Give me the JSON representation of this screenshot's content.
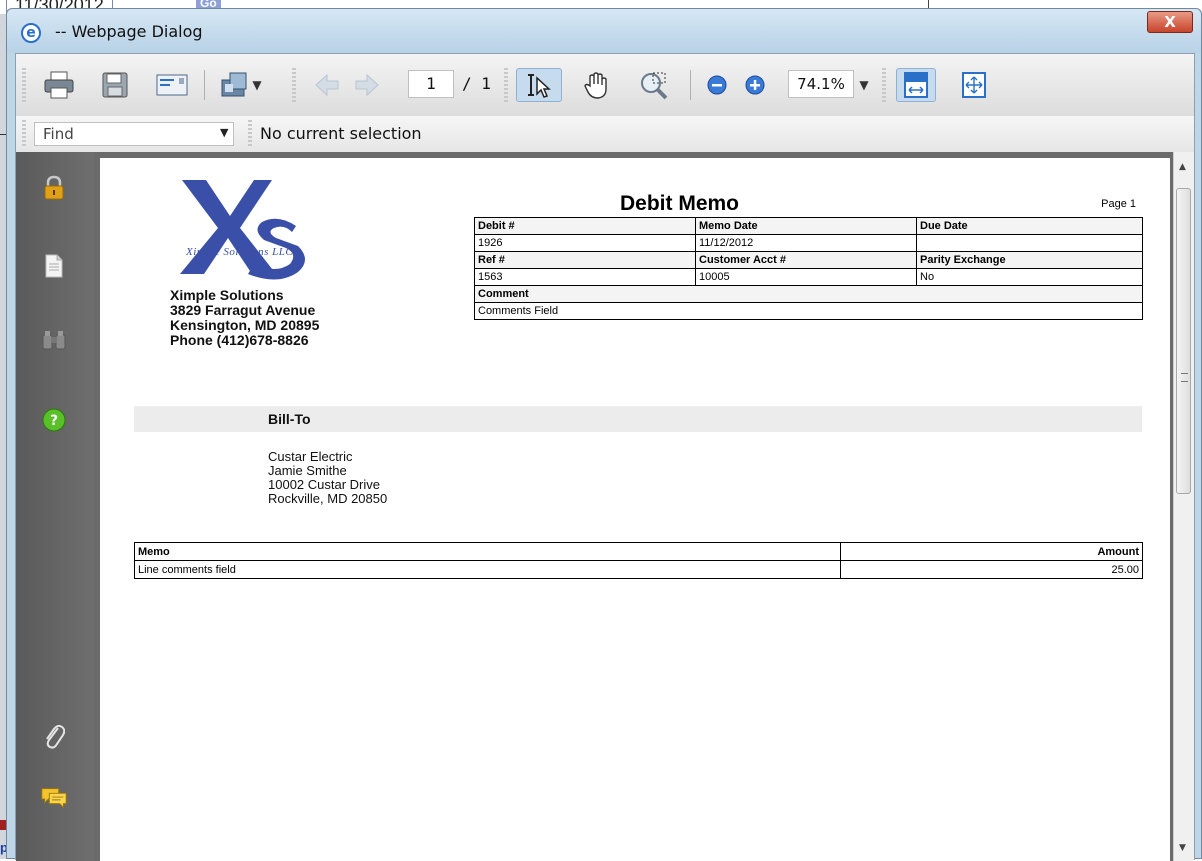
{
  "background": {
    "date_value": "11/30/2012",
    "go_label": "Go",
    "link_fragment": "p"
  },
  "dialog": {
    "title": "-- Webpage Dialog",
    "close_label": "X"
  },
  "toolbar": {
    "current_page": "1",
    "total_pages": "/ 1",
    "zoom": "74.1%"
  },
  "findbar": {
    "placeholder": "Find",
    "status": "No current selection"
  },
  "document": {
    "logo_sub": "Ximple Solutions LLC",
    "company": {
      "name": "Ximple Solutions",
      "address": "3829 Farragut Avenue",
      "city": "Kensington, MD  20895",
      "phone": "Phone (412)678-8826"
    },
    "title": "Debit Memo",
    "page_label": "Page 1",
    "header": {
      "debit_label": "Debit #",
      "debit_value": "1926",
      "memo_date_label": "Memo Date",
      "memo_date_value": "11/12/2012",
      "due_date_label": "Due Date",
      "due_date_value": "",
      "ref_label": "Ref #",
      "ref_value": "1563",
      "acct_label": "Customer Acct #",
      "acct_value": "10005",
      "parity_label": "Parity Exchange",
      "parity_value": "No",
      "comment_label": "Comment",
      "comment_value": "Comments Field"
    },
    "bill_to": {
      "label": "Bill-To",
      "line1": "Custar Electric",
      "line2": "Jamie  Smithe",
      "line3": "10002 Custar Drive",
      "line4": "Rockville, MD  20850"
    },
    "memo_table": {
      "memo_header": "Memo",
      "amount_header": "Amount",
      "rows": [
        {
          "memo": "Line comments field",
          "amount": "25.00"
        }
      ]
    }
  },
  "colors": {
    "logo_blue": "#3a4fa8",
    "title_bar": "#b8d2e6",
    "close_red": "#c8442c",
    "sidebar_gray": "#5e5e5e"
  }
}
